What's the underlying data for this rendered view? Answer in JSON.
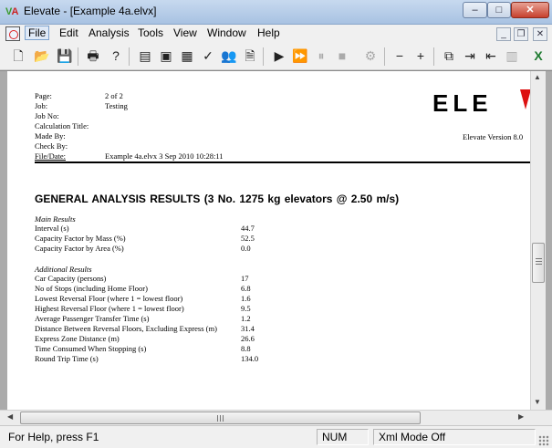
{
  "window": {
    "title": "Elevate - [Example 4a.elvx]",
    "icon_glyphs": [
      "V",
      "A"
    ],
    "minimize_glyph": "–",
    "maximize_glyph": "□",
    "close_glyph": "✕"
  },
  "menu": {
    "items": [
      "File",
      "Edit",
      "Analysis",
      "Tools",
      "View",
      "Window",
      "Help"
    ],
    "mdi_glyphs": [
      "_",
      "❐",
      "✕"
    ]
  },
  "toolbar": {
    "buttons": [
      {
        "icon": "new-icon",
        "glyph": "🗋"
      },
      {
        "icon": "open-icon",
        "glyph": "📂"
      },
      {
        "icon": "save-icon",
        "glyph": "💾"
      },
      {
        "icon": "print-icon",
        "glyph": "🖶"
      },
      {
        "icon": "help-icon",
        "glyph": "?"
      },
      {
        "icon": "data-icon",
        "glyph": "▤"
      },
      {
        "icon": "monitor-icon",
        "glyph": "▣"
      },
      {
        "icon": "view-icon",
        "glyph": "▦"
      },
      {
        "icon": "checklist-icon",
        "glyph": "✓"
      },
      {
        "icon": "people-icon",
        "glyph": "👥"
      },
      {
        "icon": "report-icon",
        "glyph": "🗎"
      },
      {
        "icon": "play-icon",
        "glyph": "▶"
      },
      {
        "icon": "fast-forward-icon",
        "glyph": "⏩"
      },
      {
        "icon": "pause-icon",
        "glyph": "⏸"
      },
      {
        "icon": "stop-icon",
        "glyph": "■"
      },
      {
        "icon": "settings-icon",
        "glyph": "⚙"
      },
      {
        "icon": "zoom-out-icon",
        "glyph": "−"
      },
      {
        "icon": "zoom-in-icon",
        "glyph": "+"
      },
      {
        "icon": "copy-icon",
        "glyph": "⧉"
      },
      {
        "icon": "export-icon",
        "glyph": "⇥"
      },
      {
        "icon": "import-icon",
        "glyph": "⇤"
      },
      {
        "icon": "chart-icon",
        "glyph": "▥"
      },
      {
        "icon": "excel-icon",
        "glyph": "X"
      }
    ]
  },
  "report": {
    "header_fields": [
      {
        "label": "Page:",
        "value": "2 of 2"
      },
      {
        "label": "Job:",
        "value": "Testing"
      },
      {
        "label": "Job No:",
        "value": ""
      },
      {
        "label": "Calculation Title:",
        "value": ""
      },
      {
        "label": "Made By:",
        "value": ""
      },
      {
        "label": "Check By:",
        "value": ""
      },
      {
        "label": "File/Date:",
        "value": "Example 4a.elvx   3 Sep 2010  10:28:11"
      }
    ],
    "brand_text": "ELE",
    "version_text": "Elevate Version 8.0",
    "section_heading": "GENERAL ANALYSIS RESULTS    (3 No. 1275 kg elevators @ 2.50 m/s)",
    "main_results": {
      "heading": "Main Results",
      "rows": [
        {
          "label": "Interval (s)",
          "value": "44.7"
        },
        {
          "label": "Capacity Factor by Mass (%)",
          "value": "52.5"
        },
        {
          "label": "Capacity Factor by Area (%)",
          "value": "0.0"
        }
      ]
    },
    "additional_results": {
      "heading": "Additional Results",
      "rows": [
        {
          "label": "Car Capacity (persons)",
          "value": "17"
        },
        {
          "label": "No of Stops (including Home Floor)",
          "value": "6.8"
        },
        {
          "label": "Lowest Reversal Floor (where 1 = lowest floor)",
          "value": "1.6"
        },
        {
          "label": "Highest Reversal Floor (where 1 = lowest floor)",
          "value": "9.5"
        },
        {
          "label": "Average Passenger Transfer Time (s)",
          "value": "1.2"
        },
        {
          "label": "Distance Between Reversal Floors, Excluding Express (m)",
          "value": "31.4"
        },
        {
          "label": "Express Zone Distance (m)",
          "value": "26.6"
        },
        {
          "label": "Time Consumed When Stopping (s)",
          "value": "8.8"
        },
        {
          "label": "Round Trip Time (s)",
          "value": "134.0"
        }
      ]
    }
  },
  "scrollbars": {
    "up_glyph": "▲",
    "down_glyph": "▼",
    "left_glyph": "◀",
    "right_glyph": "▶"
  },
  "status": {
    "help_text": "For Help, press F1",
    "num_indicator": "NUM",
    "mode_text": "Xml Mode Off"
  }
}
